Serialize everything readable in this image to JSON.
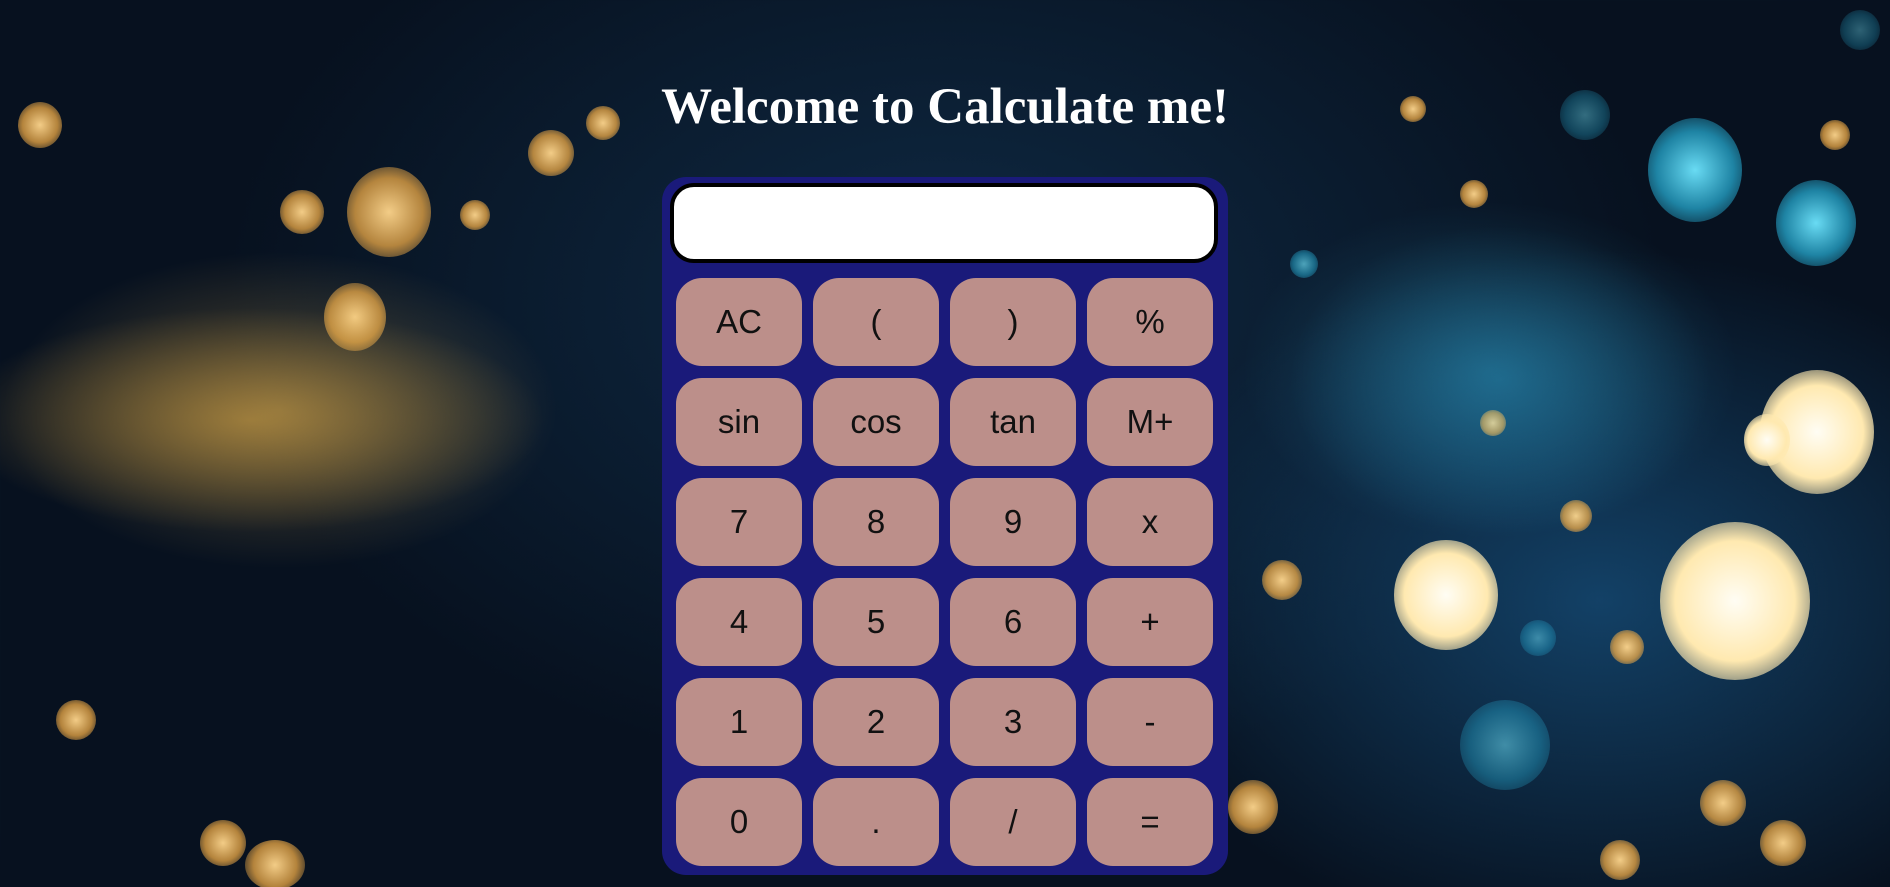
{
  "page": {
    "title": "Welcome to Calculate me!"
  },
  "calculator": {
    "display_value": "",
    "keys": [
      {
        "label": "AC",
        "name": "clear-button"
      },
      {
        "label": "(",
        "name": "open-paren-button"
      },
      {
        "label": ")",
        "name": "close-paren-button"
      },
      {
        "label": "%",
        "name": "percent-button"
      },
      {
        "label": "sin",
        "name": "sin-button"
      },
      {
        "label": "cos",
        "name": "cos-button"
      },
      {
        "label": "tan",
        "name": "tan-button"
      },
      {
        "label": "M+",
        "name": "memory-add-button"
      },
      {
        "label": "7",
        "name": "digit-7-button"
      },
      {
        "label": "8",
        "name": "digit-8-button"
      },
      {
        "label": "9",
        "name": "digit-9-button"
      },
      {
        "label": "x",
        "name": "multiply-button"
      },
      {
        "label": "4",
        "name": "digit-4-button"
      },
      {
        "label": "5",
        "name": "digit-5-button"
      },
      {
        "label": "6",
        "name": "digit-6-button"
      },
      {
        "label": "+",
        "name": "add-button"
      },
      {
        "label": "1",
        "name": "digit-1-button"
      },
      {
        "label": "2",
        "name": "digit-2-button"
      },
      {
        "label": "3",
        "name": "digit-3-button"
      },
      {
        "label": "-",
        "name": "subtract-button"
      },
      {
        "label": "0",
        "name": "digit-0-button"
      },
      {
        "label": ".",
        "name": "decimal-point-button"
      },
      {
        "label": "/",
        "name": "divide-button"
      },
      {
        "label": "=",
        "name": "equals-button"
      }
    ]
  },
  "colors": {
    "calculator_body": "#1a1a7a",
    "key_background": "#bc8f8a",
    "display_background": "#ffffff",
    "title_text": "#ffffff"
  }
}
